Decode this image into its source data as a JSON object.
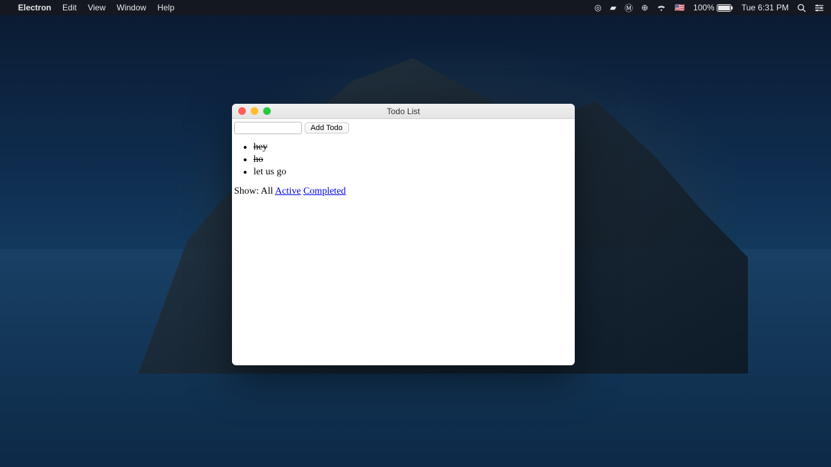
{
  "menubar": {
    "app_name": "Electron",
    "items": [
      "Edit",
      "View",
      "Window",
      "Help"
    ],
    "status": {
      "battery": "100%",
      "clock": "Tue 6:31 PM"
    }
  },
  "window": {
    "title": "Todo List",
    "add_button_label": "Add Todo",
    "input_value": ""
  },
  "todos": [
    {
      "text": "hey",
      "completed": true
    },
    {
      "text": "ho",
      "completed": true
    },
    {
      "text": "let us go",
      "completed": false
    }
  ],
  "filters": {
    "prefix": "Show: ",
    "current": "All",
    "links": [
      "Active",
      "Completed"
    ]
  }
}
